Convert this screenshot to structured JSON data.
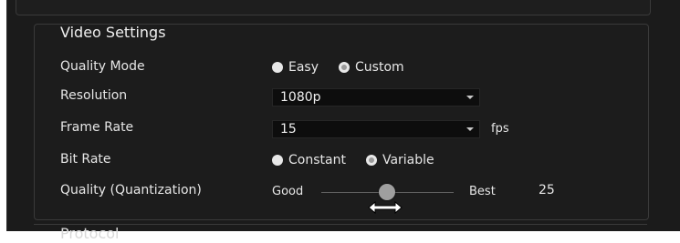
{
  "section": {
    "title": "Video Settings",
    "next_title": "Protocol"
  },
  "fields": {
    "quality_mode": {
      "label": "Quality Mode",
      "options": [
        "Easy",
        "Custom"
      ],
      "selected": "Custom"
    },
    "resolution": {
      "label": "Resolution",
      "value": "1080p"
    },
    "frame_rate": {
      "label": "Frame Rate",
      "value": "15",
      "unit": "fps"
    },
    "bit_rate": {
      "label": "Bit Rate",
      "options": [
        "Constant",
        "Variable"
      ],
      "selected": "Variable"
    },
    "quality": {
      "label": "Quality (Quantization)",
      "min_label": "Good",
      "max_label": "Best",
      "value": "25"
    }
  },
  "icons": {
    "cursor": "horizontal-resize-cursor-icon",
    "dropdown": "caret-down-icon",
    "radio_selected": "radio-selected-icon",
    "radio_unselected": "radio-unselected-icon"
  },
  "colors": {
    "background": "#1b1b1b",
    "text": "#e6e6e6",
    "select_bg": "#0d0d0d",
    "slider_thumb": "#9f9f9f"
  }
}
